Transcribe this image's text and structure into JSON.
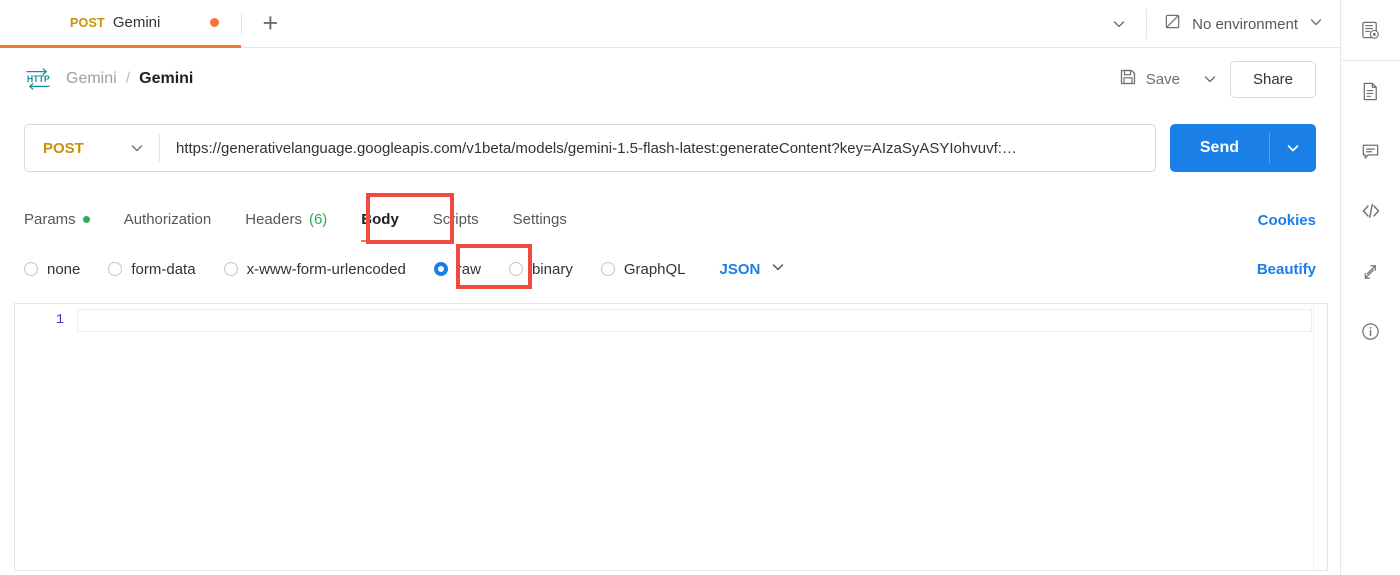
{
  "tabstrip": {
    "request_tab": {
      "method": "POST",
      "name": "Gemini",
      "unsaved_icon": "unsaved-dot"
    },
    "new_tab_label": "+",
    "tabs_chevron_icon": "chevron-down-icon",
    "environment": {
      "icon": "no-environment-icon",
      "label": "No environment",
      "chevron_icon": "chevron-down-icon"
    }
  },
  "breadcrumb": {
    "protocol_badge": "HTTP",
    "collection": "Gemini",
    "separator": "/",
    "request": "Gemini",
    "save_label": "Save",
    "save_icon": "floppy-disk-icon",
    "save_chevron_icon": "chevron-down-icon",
    "share_label": "Share"
  },
  "url_bar": {
    "method": "POST",
    "method_chevron_icon": "chevron-down-icon",
    "url": "https://generativelanguage.googleapis.com/v1beta/models/gemini-1.5-flash-latest:generateContent?key=AIzaSyASYIohvuvf:…",
    "send_label": "Send",
    "send_chevron_icon": "chevron-down-icon"
  },
  "request_tabs": {
    "items": [
      {
        "label": "Params",
        "indicator": "dot",
        "active": false
      },
      {
        "label": "Authorization",
        "indicator": "",
        "active": false
      },
      {
        "label": "Headers",
        "count": "(6)",
        "indicator": "count",
        "active": false
      },
      {
        "label": "Body",
        "indicator": "",
        "active": true
      },
      {
        "label": "Scripts",
        "indicator": "",
        "active": false
      },
      {
        "label": "Settings",
        "indicator": "",
        "active": false
      }
    ],
    "cookies_label": "Cookies"
  },
  "body_types": {
    "options": [
      {
        "label": "none",
        "selected": false
      },
      {
        "label": "form-data",
        "selected": false
      },
      {
        "label": "x-www-form-urlencoded",
        "selected": false
      },
      {
        "label": "raw",
        "selected": true
      },
      {
        "label": "binary",
        "selected": false
      },
      {
        "label": "GraphQL",
        "selected": false
      }
    ],
    "format": "JSON",
    "format_chevron_icon": "chevron-down-icon",
    "beautify_label": "Beautify"
  },
  "editor": {
    "line_numbers": [
      "1"
    ],
    "content": ""
  },
  "right_rail": {
    "icons": [
      "environment-quick-look-icon",
      "documentation-icon",
      "comments-icon",
      "code-snippet-icon",
      "request-runner-icon",
      "info-icon"
    ]
  },
  "annotations": [
    {
      "name": "body-tab-highlight",
      "color": "#f04a3f"
    },
    {
      "name": "raw-option-highlight",
      "color": "#f04a3f"
    }
  ]
}
